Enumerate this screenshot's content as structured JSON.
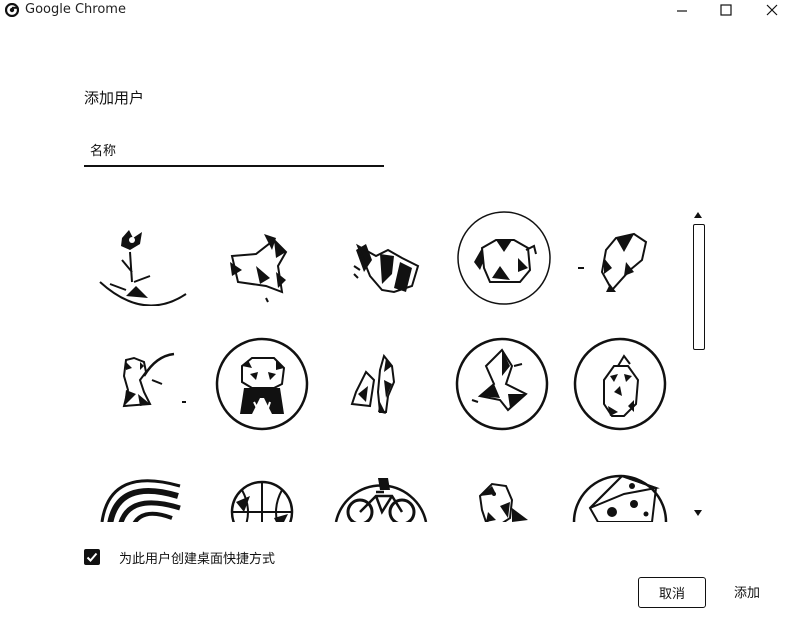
{
  "window": {
    "title": "Google Chrome",
    "controls": [
      "minimize-icon",
      "maximize-icon",
      "close-icon"
    ]
  },
  "dialog": {
    "heading": "添加用户",
    "name_field": {
      "value": "",
      "placeholder": "名称"
    },
    "avatars": [
      {
        "icon": "cat-icon",
        "selected": false
      },
      {
        "icon": "fox-icon",
        "selected": false
      },
      {
        "icon": "dragon-icon",
        "selected": false
      },
      {
        "icon": "elephant-icon",
        "selected": true
      },
      {
        "icon": "dog-icon",
        "selected": false
      },
      {
        "icon": "ninja-icon",
        "selected": false
      },
      {
        "icon": "panda-icon",
        "selected": false
      },
      {
        "icon": "penguins-icon",
        "selected": false
      },
      {
        "icon": "crane-icon",
        "selected": false
      },
      {
        "icon": "owl-icon",
        "selected": false
      },
      {
        "icon": "rainbow-icon",
        "selected": false
      },
      {
        "icon": "basketball-icon",
        "selected": false
      },
      {
        "icon": "bicycle-icon",
        "selected": false
      },
      {
        "icon": "bird-icon",
        "selected": false
      },
      {
        "icon": "cheese-icon",
        "selected": false
      }
    ],
    "shortcut_checkbox": {
      "checked": true,
      "label": "为此用户创建桌面快捷方式"
    },
    "buttons": {
      "cancel": "取消",
      "add": "添加"
    }
  }
}
